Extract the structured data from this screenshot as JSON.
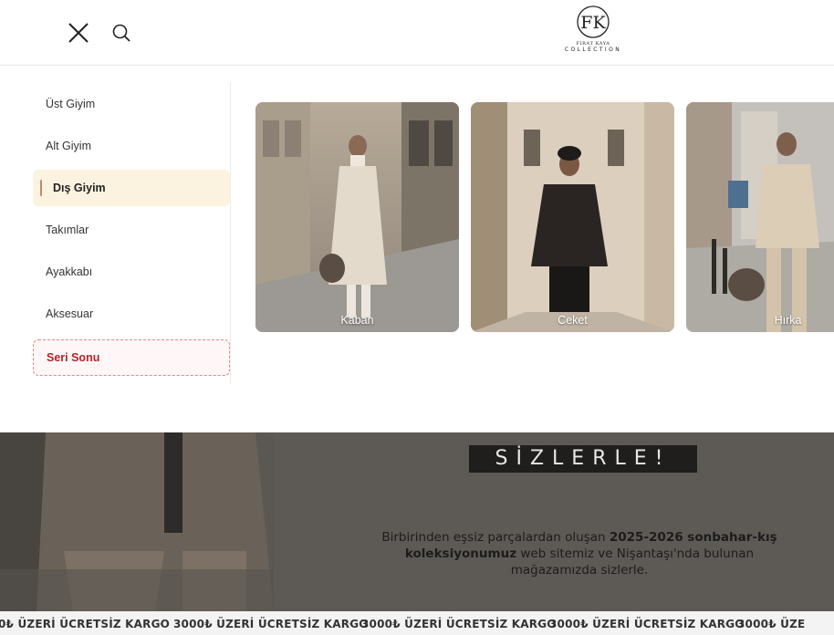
{
  "header": {
    "close_icon": "close-icon",
    "search_icon": "search-icon",
    "logo": {
      "line1": "FIRAT KAYA",
      "line2": "COLLECTION",
      "monogram": "FK"
    }
  },
  "menu": {
    "categories": [
      {
        "label": "Üst Giyim",
        "state": "normal"
      },
      {
        "label": "Alt Giyim",
        "state": "normal"
      },
      {
        "label": "Dış Giyim",
        "state": "active"
      },
      {
        "label": "Takımlar",
        "state": "normal"
      },
      {
        "label": "Ayakkabı",
        "state": "normal"
      },
      {
        "label": "Aksesuar",
        "state": "normal"
      },
      {
        "label": "Seri Sonu",
        "state": "sale"
      }
    ],
    "cards": [
      {
        "label": "Kaban"
      },
      {
        "label": "Ceket"
      },
      {
        "label": "Hırka"
      }
    ]
  },
  "banner": {
    "heading": "SİZLERLE!",
    "text_part1": "Birbirinden eşsiz parçalardan oluşan ",
    "text_bold1": "2025-2026 sonbahar-kış koleksiyonumuz",
    "text_part2": " web sitemiz ve Nişantaşı'nda bulunan mağazamızda sizlerle."
  },
  "marquee": {
    "items": [
      "0₺ ÜZERİ ÜCRETSİZ KARGO",
      "3000₺ ÜZERİ ÜCRETSİZ KARGO",
      "3000₺ ÜZERİ ÜCRETSİZ KARGO",
      "3000₺ ÜZERİ ÜCRETSİZ KARGO",
      "3000₺ ÜZERİ ÜCRETSİZ KARGO",
      "3000₺ ÜZE"
    ],
    "separator": "·"
  },
  "colors": {
    "active_bg": "#fbf3e0",
    "active_bar": "#c4876b",
    "sale_border": "#e6868a",
    "sale_text": "#b3232a"
  }
}
